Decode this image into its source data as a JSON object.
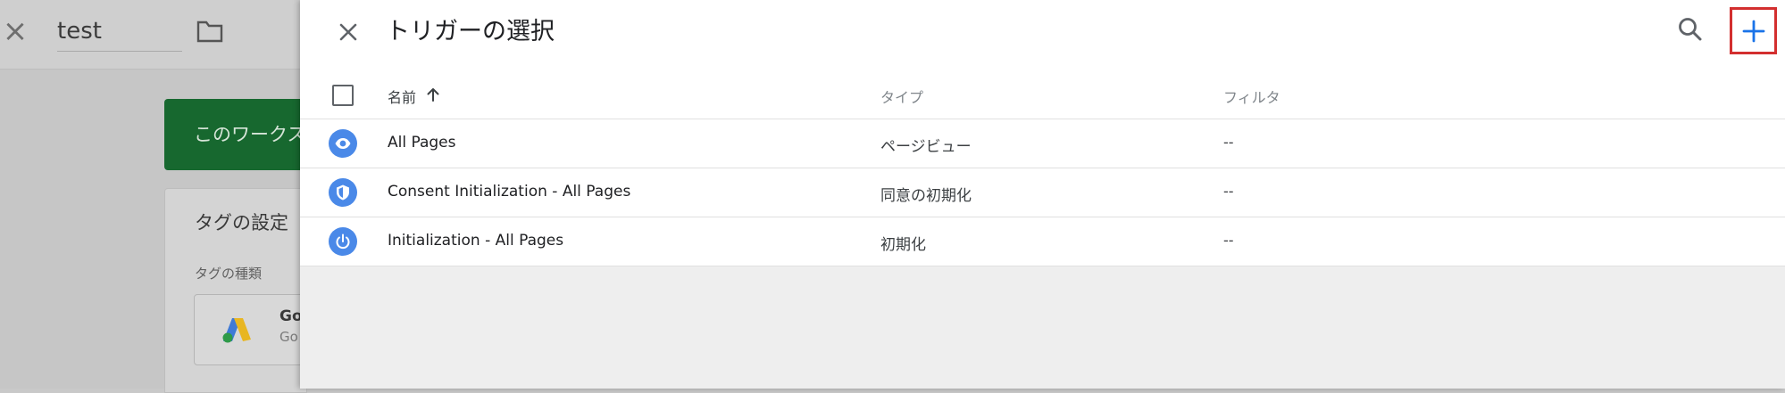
{
  "background": {
    "tag_name": "test",
    "banner_text": "このワークス",
    "card_title": "タグの設定",
    "card_subtitle": "タグの種類",
    "tag_type_line1": "Go",
    "tag_type_line2": "Go"
  },
  "panel": {
    "title": "トリガーの選択",
    "columns": {
      "name": "名前",
      "type": "タイプ",
      "filter": "フィルタ"
    },
    "triggers": [
      {
        "icon": "eye-icon",
        "name": "All Pages",
        "type": "ページビュー",
        "filter": "--"
      },
      {
        "icon": "shield-icon",
        "name": "Consent Initialization - All Pages",
        "type": "同意の初期化",
        "filter": "--"
      },
      {
        "icon": "power-icon",
        "name": "Initialization - All Pages",
        "type": "初期化",
        "filter": "--"
      }
    ]
  },
  "colors": {
    "accent_blue": "#4a89e8",
    "add_highlight": "#d32f2f",
    "banner_green": "#17682f"
  }
}
